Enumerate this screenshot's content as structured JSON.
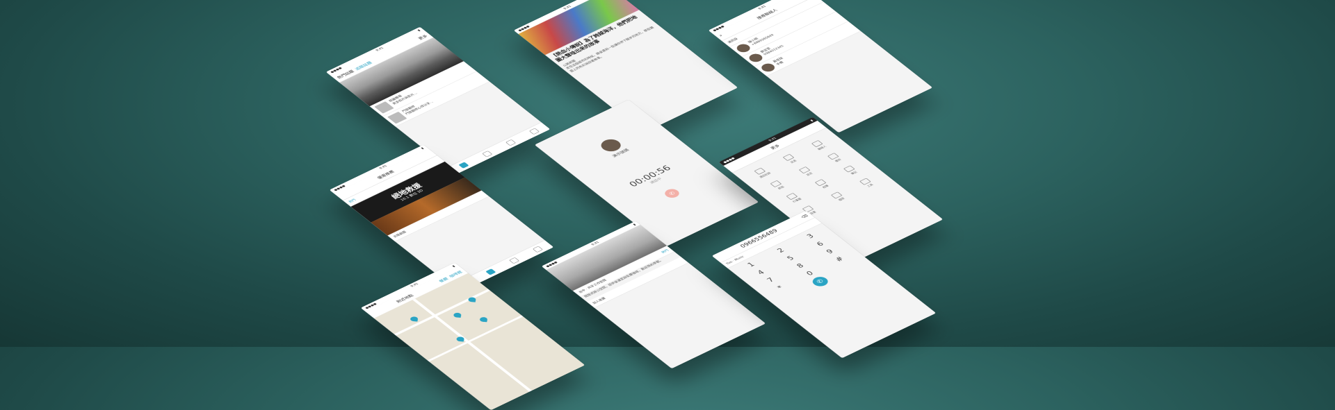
{
  "screens": {
    "feed": {
      "tab_left": "熱門話題",
      "tab_right": "追蹤話題",
      "more": "更多",
      "items": [
        {
          "title": "桃園機場",
          "desc": "更多照片與影片…"
        },
        {
          "title": "門窗翻修",
          "desc": "門窗翻修心得分享…"
        }
      ]
    },
    "article": {
      "headline": "【熱血小傳說】為了跨越海洋，他們把地圖大聲唸出來的故事",
      "tag": "公路新聞",
      "body": "走在這個城市的時候，總會遇到一些讓你停下腳步的地方，那些牆面上的色彩訴說著故事。"
    },
    "contacts": {
      "search_placeholder": "搜尋聯絡人",
      "header": "通訊錄",
      "items": [
        {
          "name": "陳小明",
          "sub": "+8869265849"
        },
        {
          "name": "鄭宜萱",
          "sub": "0984012345"
        },
        {
          "name": "黃佳琪",
          "sub": "手機"
        }
      ]
    },
    "promo": {
      "header": "優惠推薦",
      "banner_title": "絕地救援",
      "banner_sub": "10.1 數位 3D",
      "tag": "熱門",
      "item": "太陽劇團"
    },
    "call": {
      "caller": "演示號碼",
      "timer": "00:00:56",
      "status": "通話中"
    },
    "menu": {
      "header": "更多",
      "cells": [
        "通話紀錄",
        "訊息",
        "聯絡人",
        "群組",
        "設定",
        "備份",
        "行事曆",
        "相簿",
        "筆記",
        "音樂",
        "檔案",
        "工具"
      ]
    },
    "map": {
      "search": "附近地點",
      "btn_a": "餐廳",
      "btn_b": "咖啡館"
    },
    "space": {
      "badge": "熱門",
      "title": "台中 · 共享工作空間",
      "desc": "開放式辦公空間，提供會議室與免費咖啡，歡迎預約參觀。",
      "footer": "加入收藏"
    },
    "dialer": {
      "number": "0966556489",
      "suggestion": "Tim · Music",
      "keys": [
        "1",
        "2",
        "3",
        "4",
        "5",
        "6",
        "7",
        "8",
        "9",
        "*",
        "0",
        "#"
      ]
    }
  },
  "colors": {
    "accent": "#2aa4c4",
    "background": "#2c625f"
  }
}
